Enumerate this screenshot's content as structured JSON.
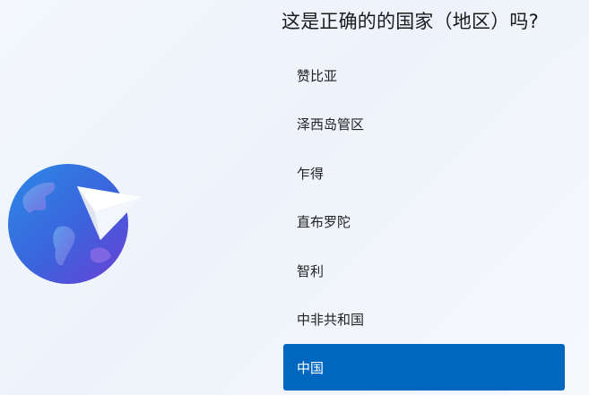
{
  "page": {
    "question": "这是正确的的国家（地区）吗?"
  },
  "regions": {
    "items": [
      {
        "label": "赞比亚",
        "selected": false
      },
      {
        "label": "泽西岛管区",
        "selected": false
      },
      {
        "label": "乍得",
        "selected": false
      },
      {
        "label": "直布罗陀",
        "selected": false
      },
      {
        "label": "智利",
        "selected": false
      },
      {
        "label": "中非共和国",
        "selected": false
      },
      {
        "label": "中国",
        "selected": true
      }
    ]
  },
  "icons": {
    "illustration": "globe-with-paper-plane-icon"
  },
  "colors": {
    "accent": "#0067c0",
    "globe_blue": "#2f7fe0",
    "globe_purple": "#6a46d8"
  }
}
